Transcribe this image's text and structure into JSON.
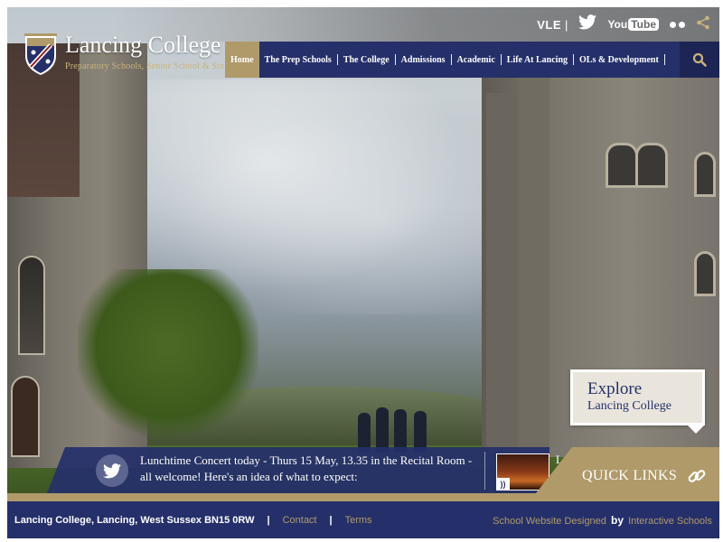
{
  "social": {
    "vle_label": "VLE",
    "separator": "|",
    "youtube_you": "You",
    "youtube_tube": "Tube",
    "icons": [
      "twitter-icon",
      "youtube-icon",
      "flickr-icon",
      "share-icon"
    ]
  },
  "logo": {
    "title": "Lancing College",
    "subtitle": "Preparatory Schools, Senior School & Sixth Form"
  },
  "nav": {
    "items": [
      {
        "label": "Home",
        "active": true
      },
      {
        "label": "The Prep Schools"
      },
      {
        "label": "The College"
      },
      {
        "label": "Admissions"
      },
      {
        "label": "Academic"
      },
      {
        "label": "Life At Lancing"
      },
      {
        "label": "OLs & Development"
      }
    ],
    "search_icon": "search-icon"
  },
  "explore": {
    "title": "Explore",
    "subtitle": "Lancing College"
  },
  "news": {
    "text": "Lunchtime Concert today - Thurs 15 May, 13.35 in the Recital Room - all welcome! Here's an idea of what to expect:",
    "truncated_next": "La",
    "rss_icon": "rss-icon"
  },
  "quick_links": {
    "label": "QUICK LINKS"
  },
  "footer": {
    "address": "Lancing College, Lancing, West Sussex BN15 0RW",
    "separator": "|",
    "contact": "Contact",
    "terms": "Terms",
    "credit_prefix": "School Website Designed",
    "credit_by": "by",
    "credit_company": "Interactive Schools"
  },
  "colors": {
    "navy": "#25306a",
    "gold": "#b09a6a",
    "explore_bg": "#e9e5dc"
  }
}
